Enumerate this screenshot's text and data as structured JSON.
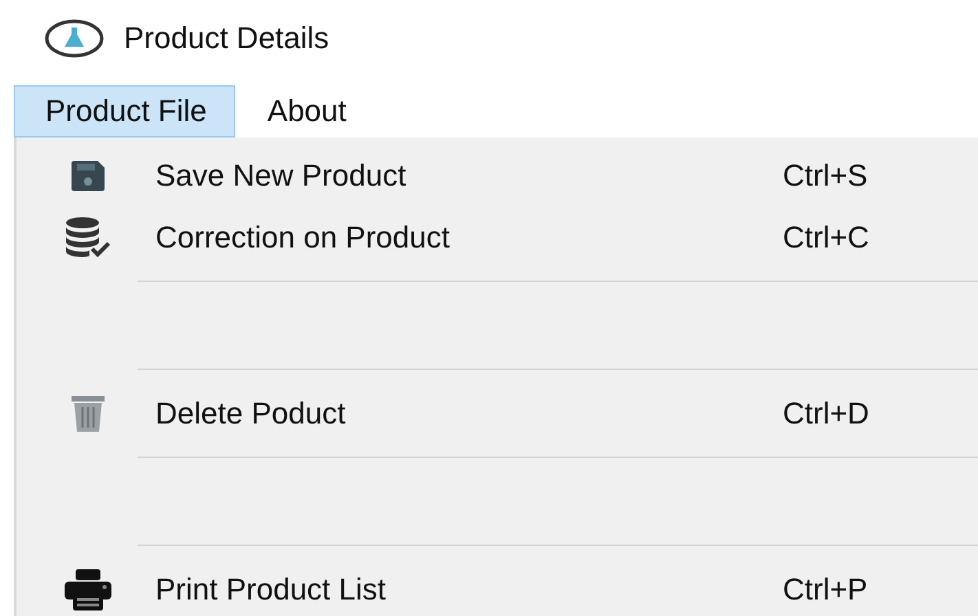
{
  "window": {
    "title": "Product Details"
  },
  "menu_bar": [
    {
      "label": "Product File",
      "selected": true
    },
    {
      "label": "About",
      "selected": false
    }
  ],
  "dropdown": [
    {
      "kind": "item",
      "label": "Save New Product",
      "shortcut": "Ctrl+S"
    },
    {
      "kind": "item",
      "label": "Correction on Product",
      "shortcut": "Ctrl+C"
    },
    {
      "kind": "separator"
    },
    {
      "kind": "empty"
    },
    {
      "kind": "separator"
    },
    {
      "kind": "item",
      "label": "Delete Poduct",
      "shortcut": "Ctrl+D"
    },
    {
      "kind": "separator"
    },
    {
      "kind": "empty"
    },
    {
      "kind": "separator"
    },
    {
      "kind": "item",
      "label": "Print Product List",
      "shortcut": "Ctrl+P"
    }
  ]
}
